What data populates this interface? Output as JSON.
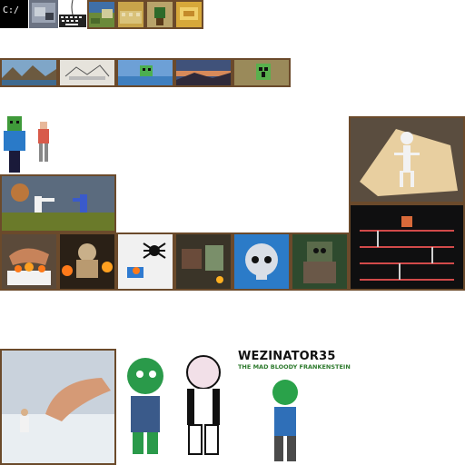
{
  "thumbnails": {
    "row1": [
      "terminal",
      "desktop-screenshot",
      "keyboard",
      "landscape-painting",
      "pixel-tiles",
      "green-plant-pixel",
      "gold-pixel"
    ],
    "row2": [
      "mountains-pixel",
      "white-sketch",
      "creeper-lake",
      "sunset",
      "creeper-pixel"
    ],
    "row3": [
      "karate-fight",
      "skeleton-cheese"
    ],
    "row4": [
      "hand-fire",
      "bust-fire",
      "spider",
      "diorama",
      "skull",
      "creature",
      "donkey-kong"
    ],
    "row5": [
      "karate-giant-hand"
    ]
  },
  "terminal": {
    "prompt": "C:/"
  },
  "comic": {
    "title": "WEZINATOR35",
    "subtitle": "THE MAD BLOODY FRANKENSTEIN"
  }
}
